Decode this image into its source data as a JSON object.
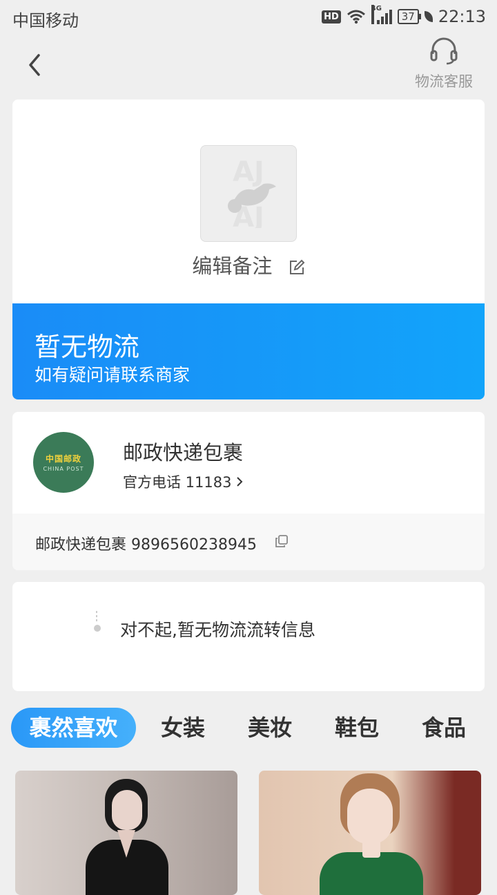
{
  "status_bar": {
    "carrier": "中国移动",
    "network_badge": "HD",
    "signal_label": "4G",
    "battery": "37",
    "time": "22:13"
  },
  "header": {
    "customer_service_label": "物流客服",
    "icons": [
      "back-arrow-icon",
      "headset-icon"
    ]
  },
  "package": {
    "edit_remark_label": "编辑备注",
    "icons": [
      "package-placeholder-icon",
      "edit-icon"
    ]
  },
  "logistics_status": {
    "title": "暂无物流",
    "subtitle": "如有疑问请联系商家",
    "gradient": [
      "#1a8cf7",
      "#12a4fa"
    ]
  },
  "courier": {
    "name": "邮政快递包裹",
    "phone_label": "官方电话 11183",
    "tracking_line": "邮政快递包裹 9896560238945",
    "logo_text_cn": "中国邮政",
    "logo_text_en": "CHINA POST",
    "logo_color": "#3b7b58"
  },
  "tracking_info": {
    "message": "对不起,暂无物流流转信息"
  },
  "recommend_tabs": [
    {
      "label": "裹然喜欢",
      "active": true
    },
    {
      "label": "女装",
      "active": false
    },
    {
      "label": "美妆",
      "active": false
    },
    {
      "label": "鞋包",
      "active": false
    },
    {
      "label": "食品",
      "active": false
    }
  ],
  "accent_color": "#1a8cf7"
}
